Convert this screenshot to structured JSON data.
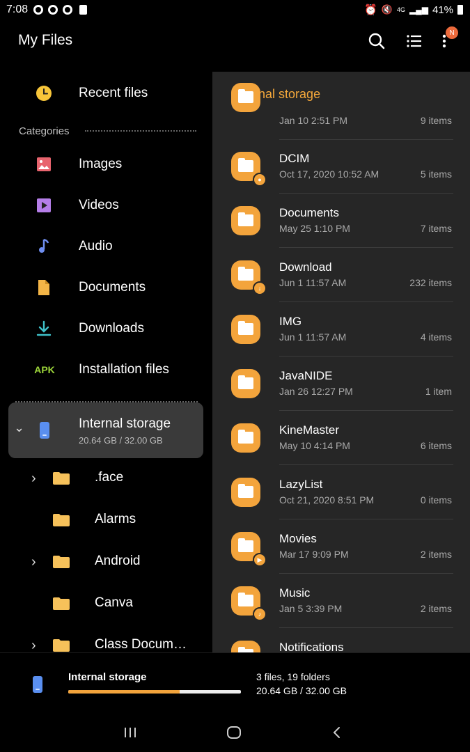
{
  "status": {
    "time": "7:08",
    "signal": "4G",
    "battery": "41%"
  },
  "header": {
    "title": "My Files",
    "badge": "N",
    "icons": [
      "search-icon",
      "list-view-icon",
      "more-options-icon"
    ]
  },
  "sidebar": {
    "recent": "Recent files",
    "categories_label": "Categories",
    "categories": [
      {
        "label": "Images",
        "icon": "image-icon",
        "color": "#e8646e"
      },
      {
        "label": "Videos",
        "icon": "video-icon",
        "color": "#b57ee8"
      },
      {
        "label": "Audio",
        "icon": "audio-icon",
        "color": "#6f8ef0"
      },
      {
        "label": "Documents",
        "icon": "document-icon",
        "color": "#f3b547"
      },
      {
        "label": "Downloads",
        "icon": "download-icon",
        "color": "#3fc1c9"
      },
      {
        "label": "Installation files",
        "icon": "apk-icon",
        "icon_text": "APK",
        "color": "#9dd63a"
      }
    ],
    "storage": {
      "label": "Internal storage",
      "sub": "20.64 GB / 32.00 GB"
    },
    "tree": [
      {
        "label": ".face",
        "expandable": true
      },
      {
        "label": "Alarms",
        "expandable": false
      },
      {
        "label": "Android",
        "expandable": true
      },
      {
        "label": "Canva",
        "expandable": false
      },
      {
        "label": "Class Docum…",
        "expandable": true
      }
    ]
  },
  "panel": {
    "title": "Internal storage",
    "rows": [
      {
        "name": "",
        "date": "Jan 10 2:51 PM",
        "count": "9 items",
        "badge": ""
      },
      {
        "name": "DCIM",
        "date": "Oct 17, 2020 10:52 AM",
        "count": "5 items",
        "badge": "camera-icon"
      },
      {
        "name": "Documents",
        "date": "May 25 1:10 PM",
        "count": "7 items",
        "badge": ""
      },
      {
        "name": "Download",
        "date": "Jun 1 11:57 AM",
        "count": "232 items",
        "badge": "download-icon"
      },
      {
        "name": "IMG",
        "date": "Jun 1 11:57 AM",
        "count": "4 items",
        "badge": ""
      },
      {
        "name": "JavaNIDE",
        "date": "Jan 26 12:27 PM",
        "count": "1 item",
        "badge": ""
      },
      {
        "name": "KineMaster",
        "date": "May 10 4:14 PM",
        "count": "6 items",
        "badge": ""
      },
      {
        "name": "LazyList",
        "date": "Oct 21, 2020 8:51 PM",
        "count": "0 items",
        "badge": ""
      },
      {
        "name": "Movies",
        "date": "Mar 17 9:09 PM",
        "count": "2 items",
        "badge": "play-icon"
      },
      {
        "name": "Music",
        "date": "Jan 5 3:39 PM",
        "count": "2 items",
        "badge": "music-note-icon"
      },
      {
        "name": "Notifications",
        "date": "",
        "count": "",
        "badge": ""
      }
    ]
  },
  "bottom": {
    "label": "Internal storage",
    "files": "3 files, 19 folders",
    "size": "20.64 GB / 32.00 GB",
    "usage_fraction": 0.645
  },
  "navbar": {
    "icons": [
      "recent-apps-icon",
      "home-icon",
      "back-icon"
    ]
  }
}
